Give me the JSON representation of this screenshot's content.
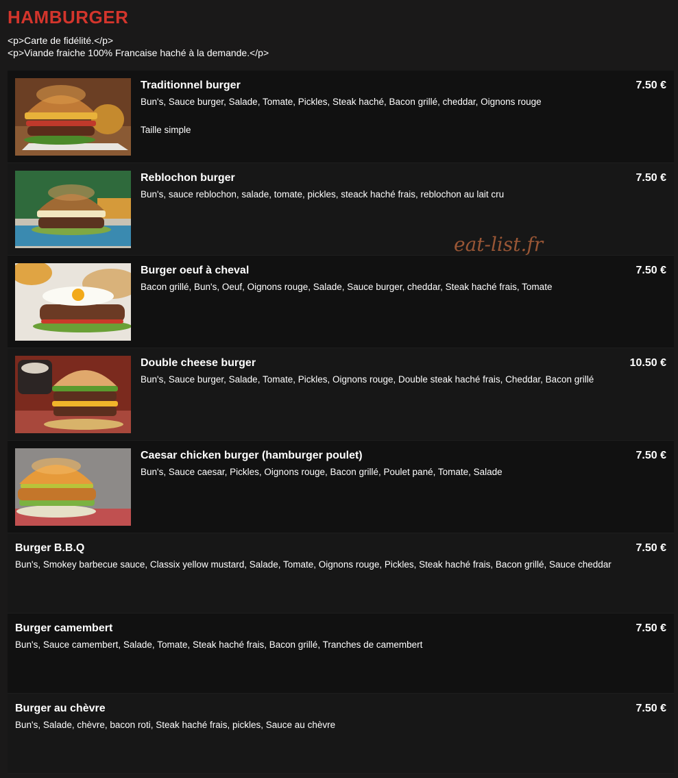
{
  "header": {
    "title": "HAMBURGER",
    "intro_line_1": "<p>Carte de fidélité.</p>",
    "intro_line_2": "<p>Viande fraiche 100% Francaise haché à la demande.</p>"
  },
  "watermark": "eat-list.fr",
  "colors": {
    "title": "#d3352c",
    "watermark": "#b0613b",
    "background": "#1a1919"
  },
  "items": [
    {
      "name": "Traditionnel burger",
      "description": "Bun's, Sauce burger, Salade, Tomate, Pickles, Steak haché, Bacon grillé, cheddar, Oignons rouge",
      "extra": "Taille  simple",
      "price": "7.50 €",
      "image": "traditionnel-burger-photo"
    },
    {
      "name": "Reblochon burger",
      "description": "Bun's, sauce reblochon, salade, tomate, pickles, steack haché frais, reblochon au lait cru",
      "price": "7.50 €",
      "image": "reblochon-burger-photo"
    },
    {
      "name": "Burger oeuf à cheval",
      "description": "Bacon grillé, Bun's, Oeuf, Oignons rouge, Salade, Sauce burger, cheddar, Steak haché frais, Tomate",
      "price": "7.50 €",
      "image": "burger-oeuf-photo"
    },
    {
      "name": "Double cheese burger",
      "description": "Bun's, Sauce burger, Salade, Tomate, Pickles, Oignons rouge, Double steak haché frais, Cheddar, Bacon grillé",
      "price": "10.50 €",
      "image": "double-cheese-photo"
    },
    {
      "name": "Caesar chicken burger (hamburger poulet)",
      "description": "Bun's, Sauce caesar, Pickles, Oignons rouge, Bacon grillé, Poulet pané, Tomate, Salade",
      "price": "7.50 €",
      "image": "caesar-chicken-photo"
    },
    {
      "name": "Burger B.B.Q",
      "description": "Bun's, Smokey barbecue sauce, Classix yellow mustard, Salade, Tomate, Oignons rouge, Pickles, Steak haché frais, Bacon grillé, Sauce cheddar",
      "price": "7.50 €"
    },
    {
      "name": "Burger camembert",
      "description": "Bun's, Sauce camembert, Salade, Tomate, Steak haché frais, Bacon grillé, Tranches de camembert",
      "price": "7.50 €"
    },
    {
      "name": "Burger au chèvre",
      "description": "Bun's, Salade, chèvre, bacon roti, Steak haché frais, pickles, Sauce au chèvre",
      "price": "7.50 €"
    }
  ]
}
